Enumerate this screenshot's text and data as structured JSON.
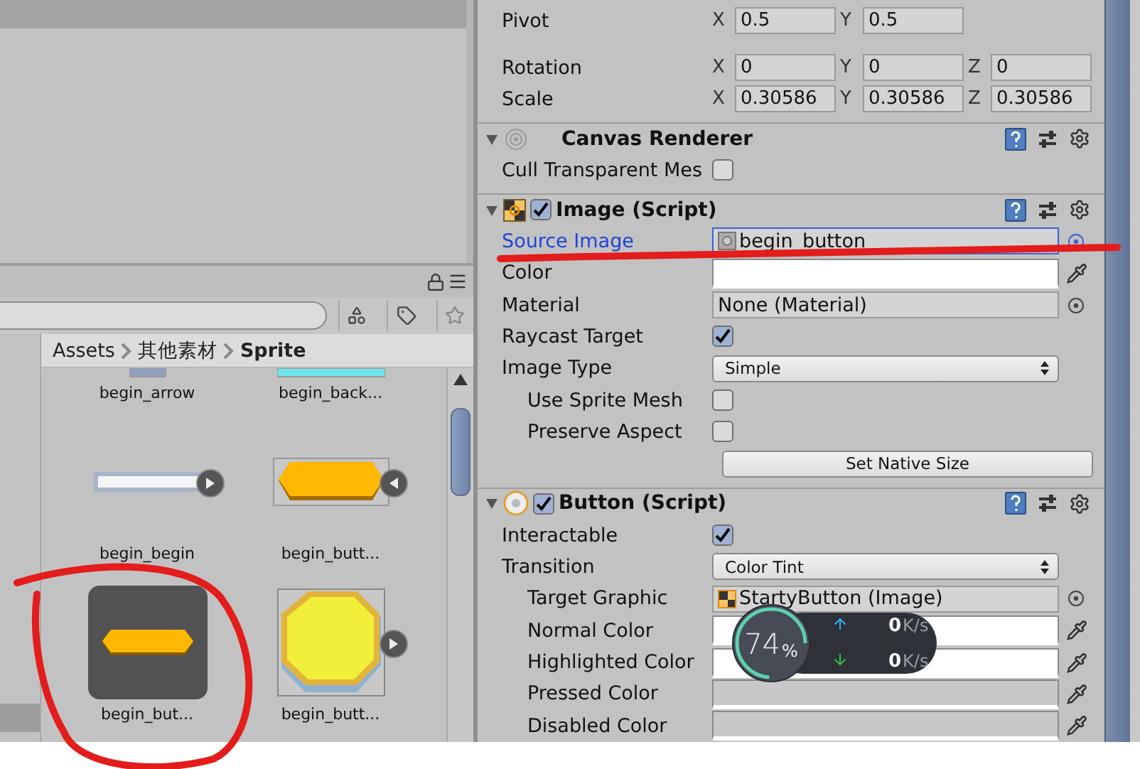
{
  "project": {
    "breadcrumb": [
      "Assets",
      "其他素材",
      "Sprite"
    ],
    "assets": [
      {
        "name": "begin_arrow",
        "selected": false
      },
      {
        "name": "begin_back...",
        "selected": false
      },
      {
        "name": "begin_begin",
        "selected": false,
        "expanded": false
      },
      {
        "name": "begin_butt...",
        "selected": false,
        "expanded": true
      },
      {
        "name": "begin_but...",
        "selected": true
      },
      {
        "name": "begin_butt...",
        "selected": false,
        "expanded": false
      }
    ]
  },
  "inspector": {
    "transform": [
      {
        "label": "Pivot",
        "fields": [
          {
            "axis": "X",
            "value": "0.5"
          },
          {
            "axis": "Y",
            "value": "0.5"
          }
        ]
      },
      {
        "label": "Rotation",
        "fields": [
          {
            "axis": "X",
            "value": "0"
          },
          {
            "axis": "Y",
            "value": "0"
          },
          {
            "axis": "Z",
            "value": "0"
          }
        ]
      },
      {
        "label": "Scale",
        "fields": [
          {
            "axis": "X",
            "value": "0.30586"
          },
          {
            "axis": "Y",
            "value": "0.30586"
          },
          {
            "axis": "Z",
            "value": "0.30586"
          }
        ]
      }
    ],
    "components": [
      {
        "title": "Canvas Renderer",
        "properties": [
          {
            "label": "Cull Transparent Mes",
            "kind": "checkbox",
            "checked": false
          }
        ]
      },
      {
        "title": "Image (Script)",
        "enabled": true,
        "properties": [
          {
            "label": "Source Image",
            "kind": "object",
            "value": "begin_button",
            "focused": true
          },
          {
            "label": "Color",
            "kind": "color",
            "color": "#ffffff"
          },
          {
            "label": "Material",
            "kind": "object",
            "value": "None (Material)",
            "focused": false
          },
          {
            "label": "Raycast Target",
            "kind": "checkbox",
            "checked": true
          },
          {
            "label": "Image Type",
            "kind": "dropdown",
            "value": "Simple",
            "children": [
              {
                "label": "Use Sprite Mesh",
                "kind": "checkbox",
                "checked": false
              },
              {
                "label": "Preserve Aspect",
                "kind": "checkbox",
                "checked": false
              }
            ]
          },
          {
            "label": "Set Native Size",
            "kind": "button"
          }
        ]
      },
      {
        "title": "Button (Script)",
        "enabled": true,
        "properties": [
          {
            "label": "Interactable",
            "kind": "checkbox",
            "checked": true
          },
          {
            "label": "Transition",
            "kind": "dropdown",
            "value": "Color Tint",
            "children": [
              {
                "label": "Target Graphic",
                "kind": "object",
                "value": "StartyButton (Image)",
                "focused": false
              },
              {
                "label": "Normal Color",
                "kind": "color",
                "color": "#ffffff"
              },
              {
                "label": "Highlighted Color",
                "kind": "color",
                "color": "#ffffff"
              },
              {
                "label": "Pressed Color",
                "kind": "color",
                "color": "#c8c8c8"
              },
              {
                "label": "Disabled Color",
                "kind": "color",
                "color": "#c8c8c8"
              }
            ]
          }
        ]
      }
    ]
  },
  "speed_widget": {
    "level": 0.74,
    "percent": "74",
    "percent_sign": "%",
    "upload": "0",
    "upload_unit": "K/s",
    "download": "0",
    "download_unit": "K/s"
  }
}
